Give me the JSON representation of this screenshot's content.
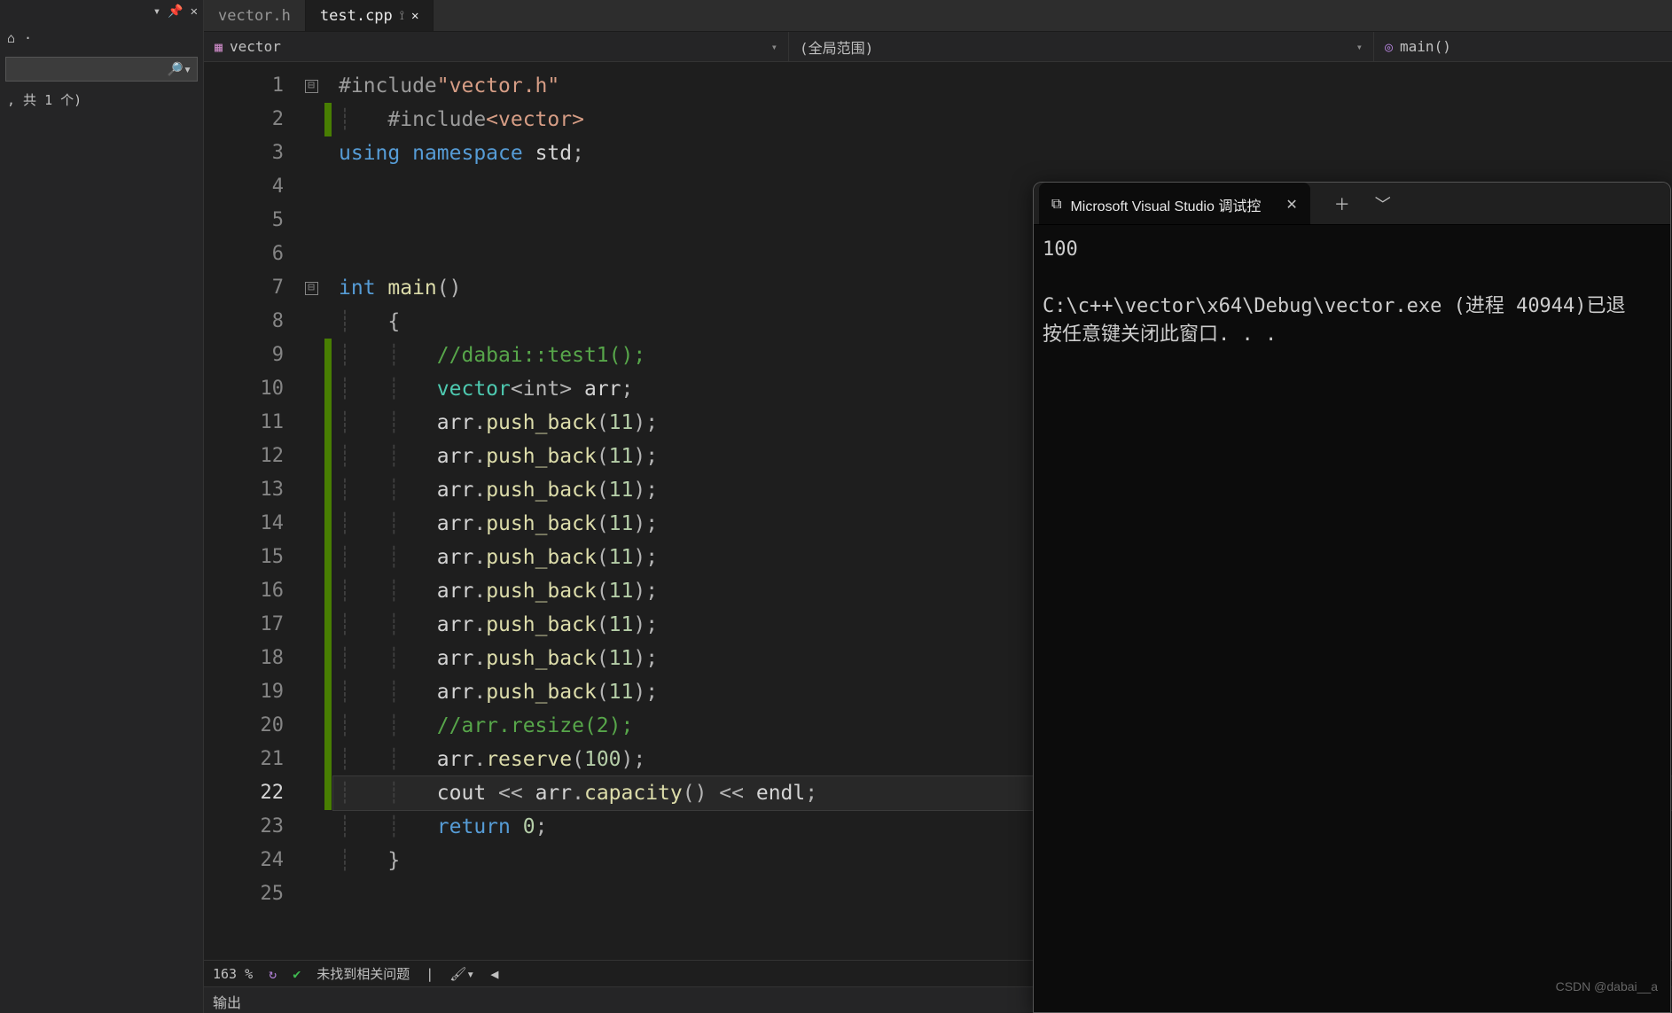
{
  "leftPanel": {
    "toolbarGlyphs": {
      "dropdown": "▾",
      "pin": "📌",
      "close": "✕"
    },
    "searchIcon": "🔎▾",
    "solutionLabel": ", 共 1 个)"
  },
  "tabs": [
    {
      "label": "vector.h",
      "active": false,
      "closable": false
    },
    {
      "label": "test.cpp",
      "active": true,
      "pinGlyph": "⟟",
      "closeGlyph": "✕"
    }
  ],
  "navbar": {
    "seg1": {
      "icon": "▦",
      "text": "vector"
    },
    "seg2": {
      "text": "(全局范围)"
    },
    "seg3": {
      "icon": "◎",
      "text": "main()"
    }
  },
  "lineNumbers": [
    1,
    2,
    3,
    4,
    5,
    6,
    7,
    8,
    9,
    10,
    11,
    12,
    13,
    14,
    15,
    16,
    17,
    18,
    19,
    20,
    21,
    22,
    23,
    24,
    25
  ],
  "currentLine": 22,
  "foldBoxes": {
    "1": "⊟",
    "7": "⊟"
  },
  "changedLines": [
    2,
    9,
    10,
    11,
    12,
    13,
    14,
    15,
    16,
    17,
    18,
    19,
    20,
    21,
    22
  ],
  "code": {
    "l1": {
      "include": "#include",
      "str": "\"vector.h\""
    },
    "l2": {
      "include": "#include",
      "ang": "<vector>"
    },
    "l3": {
      "using": "using",
      "ns": "namespace",
      "std": "std",
      "semi": ";"
    },
    "l7": {
      "int": "int",
      "main": "main",
      "paren": "()"
    },
    "l8": {
      "brace": "{"
    },
    "l9": {
      "cm": "//dabai::test1();"
    },
    "l10": {
      "vec": "vector",
      "tmpl": "<int>",
      "arr": " arr",
      "semi": ";"
    },
    "push": {
      "arr": "arr",
      "dot": ".",
      "fn": "push_back",
      "arg": "(11)",
      "semi": ";"
    },
    "l20": {
      "cm": "//arr.resize(2);"
    },
    "l21": {
      "arr": "arr",
      "dot": ".",
      "fn": "reserve",
      "arg": "(100)",
      "semi": ";"
    },
    "l22": {
      "cout": "cout",
      "op1": " << ",
      "arr": "arr",
      "dot": ".",
      "fn": "capacity",
      "paren": "()",
      "op2": " << ",
      "endl": "endl",
      "semi": ";"
    },
    "l23": {
      "ret": "return",
      "zero": " 0",
      "semi": ";"
    },
    "l24": {
      "brace": "}"
    }
  },
  "debugWindow": {
    "tabTitle": "Microsoft Visual Studio 调试控",
    "tabIcon": "⧉",
    "plus": "＋",
    "chev": "﹀",
    "closeGlyph": "✕",
    "output": "100\n\nC:\\c++\\vector\\x64\\Debug\\vector.exe (进程 40944)已退\n按任意键关闭此窗口. . ."
  },
  "statusBar": {
    "zoom": "163 %",
    "refresh": "↻",
    "okIcon": "✔",
    "issues": "未找到相关问题",
    "sep": "|",
    "brush": "🖌▾",
    "left": "◀"
  },
  "outputPanel": {
    "label": "输出"
  },
  "watermark": "CSDN @dabai__a"
}
